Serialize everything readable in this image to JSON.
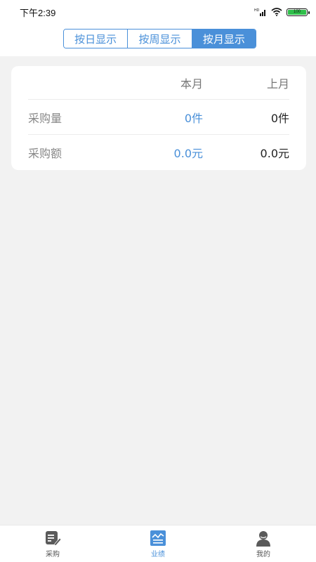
{
  "status_bar": {
    "time": "下午2:39",
    "battery": "100"
  },
  "view_toggle": {
    "options": [
      "按日显示",
      "按周显示",
      "按月显示"
    ],
    "active_index": 2
  },
  "summary_card": {
    "headers": {
      "this_month": "本月",
      "last_month": "上月"
    },
    "rows": [
      {
        "label": "采购量",
        "this_month": "0件",
        "last_month": "0件"
      },
      {
        "label": "采购额",
        "this_month": "0.0元",
        "last_month": "0.0元"
      }
    ]
  },
  "tabbar": {
    "items": [
      {
        "label": "采购",
        "icon": "edit-note-icon"
      },
      {
        "label": "业绩",
        "icon": "performance-chart-icon"
      },
      {
        "label": "我的",
        "icon": "profile-icon"
      }
    ],
    "active_index": 1
  },
  "colors": {
    "accent": "#4a90d9",
    "background": "#f2f2f2"
  }
}
